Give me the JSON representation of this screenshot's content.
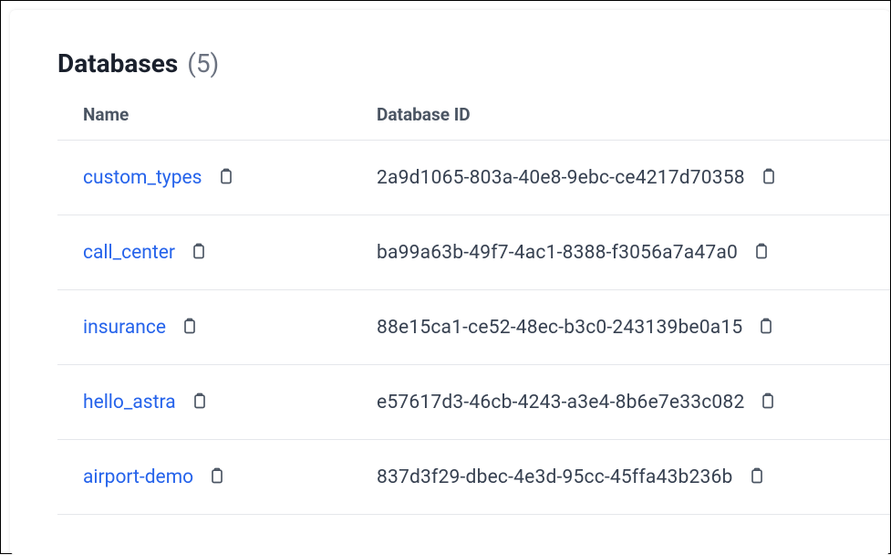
{
  "header": {
    "title": "Databases",
    "count": "(5)"
  },
  "columns": {
    "name": "Name",
    "id": "Database ID"
  },
  "rows": [
    {
      "name": "custom_types",
      "id": "2a9d1065-803a-40e8-9ebc-ce4217d70358"
    },
    {
      "name": "call_center",
      "id": "ba99a63b-49f7-4ac1-8388-f3056a7a47a0"
    },
    {
      "name": "insurance",
      "id": "88e15ca1-ce52-48ec-b3c0-243139be0a15"
    },
    {
      "name": "hello_astra",
      "id": "e57617d3-46cb-4243-a3e4-8b6e7e33c082"
    },
    {
      "name": "airport-demo",
      "id": "837d3f29-dbec-4e3d-95cc-45ffa43b236b"
    }
  ]
}
